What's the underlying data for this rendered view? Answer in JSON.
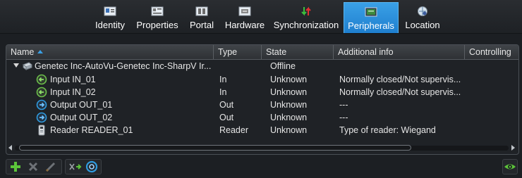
{
  "tabs": [
    {
      "label": "Identity",
      "icon": "identity-icon",
      "active": false
    },
    {
      "label": "Properties",
      "icon": "properties-icon",
      "active": false
    },
    {
      "label": "Portal",
      "icon": "portal-icon",
      "active": false
    },
    {
      "label": "Hardware",
      "icon": "hardware-icon",
      "active": false
    },
    {
      "label": "Synchronization",
      "icon": "synchronization-icon",
      "active": false
    },
    {
      "label": "Peripherals",
      "icon": "peripherals-icon",
      "active": true
    },
    {
      "label": "Location",
      "icon": "location-icon",
      "active": false
    }
  ],
  "table": {
    "columns": [
      "Name",
      "Type",
      "State",
      "Additional info",
      "Controlling"
    ],
    "sorted_column": "Name",
    "rows": [
      {
        "name": "Genetec Inc-AutoVu-Genetec Inc-SharpV Ir...",
        "type": "",
        "state": "Offline",
        "info": "",
        "icon": "camera-unit-icon",
        "level": 0,
        "expanded": true
      },
      {
        "name": "Input IN_01",
        "type": "In",
        "state": "Unknown",
        "info": "Normally closed/Not supervis...",
        "icon": "input-icon",
        "level": 1
      },
      {
        "name": "Input IN_02",
        "type": "In",
        "state": "Unknown",
        "info": "Normally closed/Not supervis...",
        "icon": "input-icon",
        "level": 1
      },
      {
        "name": "Output OUT_01",
        "type": "Out",
        "state": "Unknown",
        "info": "---",
        "icon": "output-icon",
        "level": 1
      },
      {
        "name": "Output OUT_02",
        "type": "Out",
        "state": "Unknown",
        "info": "---",
        "icon": "output-icon",
        "level": 1
      },
      {
        "name": "Reader  READER_01",
        "type": "Reader",
        "state": "Unknown",
        "info": "Type of reader: Wiegand",
        "icon": "reader-icon",
        "level": 1
      }
    ]
  },
  "toolbar": {
    "buttons": [
      "add-icon",
      "delete-icon",
      "edit-icon",
      "move-icon",
      "shunt-icon"
    ],
    "view_button": "eye-icon"
  },
  "colors": {
    "accent": "#2a8fdc",
    "add_green": "#5cc43a",
    "input_green": "#6cc04a",
    "output_blue": "#2f9be0"
  }
}
